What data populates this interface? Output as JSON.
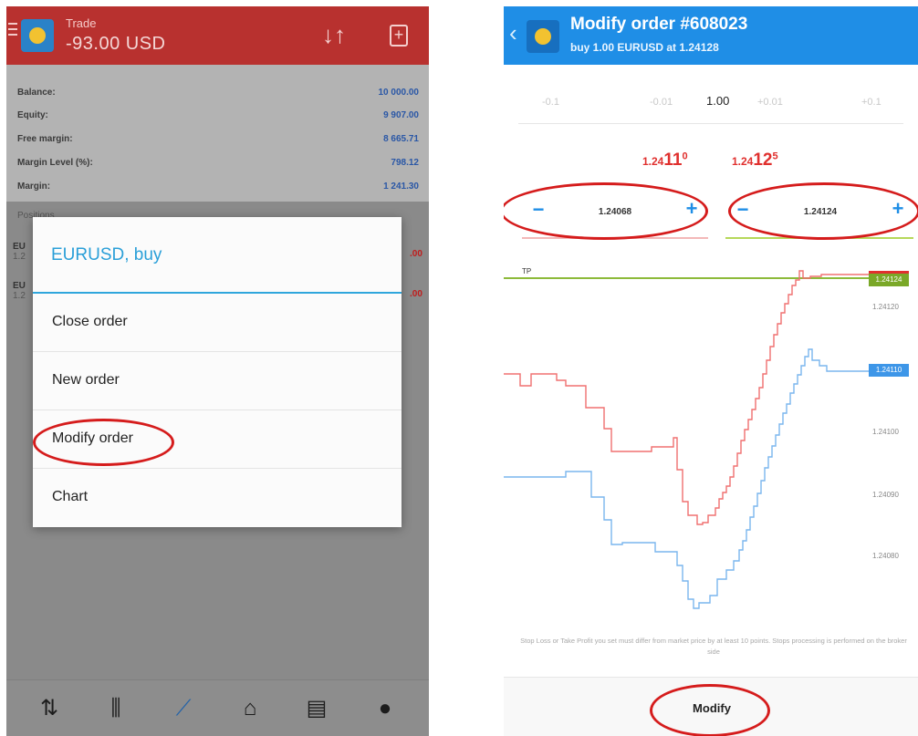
{
  "left": {
    "topbar": {
      "screen_title": "Trade",
      "profit": "-93.00 USD",
      "icons": [
        "menu-icon",
        "metatrader-logo",
        "sort-icon",
        "new-order-icon"
      ]
    },
    "account": [
      {
        "label": "Balance:",
        "value": "10 000.00"
      },
      {
        "label": "Equity:",
        "value": "9 907.00"
      },
      {
        "label": "Free margin:",
        "value": "8 665.71"
      },
      {
        "label": "Margin Level (%):",
        "value": "798.12"
      },
      {
        "label": "Margin:",
        "value": "1 241.30"
      }
    ],
    "positions_label": "Positions",
    "positions_stub": [
      {
        "symbol": "EU",
        "sub": "1.2",
        "value": ".00"
      },
      {
        "symbol": "EU",
        "sub": "1.2",
        "value": ".00"
      }
    ],
    "dialog": {
      "title": "EURUSD, buy",
      "items": [
        "Close order",
        "New order",
        "Modify order",
        "Chart"
      ]
    },
    "bottom_nav": [
      "quotes-icon",
      "chart-candles-icon",
      "trade-icon",
      "history-icon",
      "news-icon",
      "chat-icon"
    ]
  },
  "right": {
    "header": {
      "title": "Modify order #608023",
      "subtitle": "buy 1.00 EURUSD at 1.24128"
    },
    "volume": {
      "buttons_left": [
        "-0.1",
        "-0.01"
      ],
      "value": "1.00",
      "buttons_right": [
        "+0.01",
        "+0.1"
      ]
    },
    "bid": {
      "prefix": "1.24",
      "big": "11",
      "sup": "0"
    },
    "ask": {
      "prefix": "1.24",
      "big": "12",
      "sup": "5"
    },
    "stop_loss": {
      "value": "1.24068"
    },
    "take_profit": {
      "value": "1.24124"
    },
    "chart": {
      "tp_label": "TP",
      "y_ticks": [
        "1.24120",
        "1.24100",
        "1.24090",
        "1.24080"
      ],
      "tp_tag": "1.24124",
      "current_tag": "1.24110",
      "colors": {
        "ask_line": "#f07070",
        "bid_line": "#7ab6ee",
        "tp_line": "#8dba3a",
        "tp_tag": "#7aa828",
        "ask_tag": "#e0302e",
        "bid_tag": "#3d96e8"
      }
    },
    "notice": "Stop Loss or Take Profit you set must differ from market price by at least 10 points. Stops processing is performed on the broker side",
    "modify_label": "Modify"
  },
  "colors": {
    "left_header": "#b8312f",
    "right_header": "#1f8ee6",
    "dialog_accent": "#2a9fd8",
    "highlight_circle": "#d51c1c"
  }
}
